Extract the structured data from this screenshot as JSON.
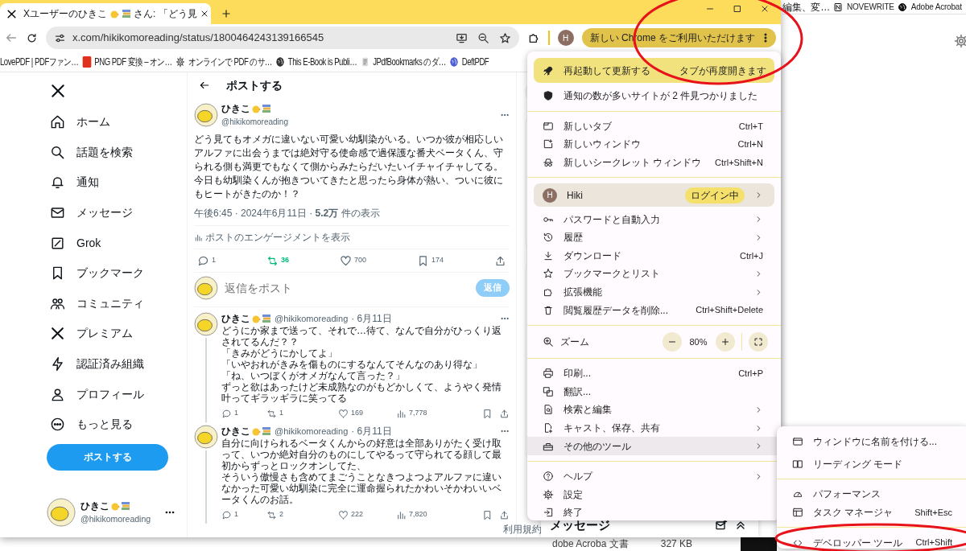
{
  "browser": {
    "tab_title_start": "Xユーザーのひきこ",
    "tab_title_end": "さん: 「どう見",
    "url": "x.com/hikikomoreading/status/1800464243139166545",
    "avatar": "H",
    "update_button": "新しい Chrome をご利用いただけます",
    "bookmarks": [
      {
        "label": "LovePDF | PDFファン…"
      },
      {
        "label": "PNG PDF 変換 – オン…"
      },
      {
        "label": "オンラインで PDF のサ…"
      },
      {
        "label": "This E-Book is Publi…"
      },
      {
        "label": "JPdfBookmarks のダ…"
      },
      {
        "label": "DeftPDF"
      }
    ]
  },
  "background_bookmarks": [
    {
      "label": "編集、変…"
    },
    {
      "label": "NOVEWRITE"
    },
    {
      "label": "Adobe Acrobat"
    }
  ],
  "nav": {
    "items": [
      {
        "label": "ホーム"
      },
      {
        "label": "話題を検索"
      },
      {
        "label": "通知"
      },
      {
        "label": "メッセージ"
      },
      {
        "label": "Grok"
      },
      {
        "label": "ブックマーク"
      },
      {
        "label": "コミュニティ"
      },
      {
        "label": "プレミアム"
      },
      {
        "label": "認証済み組織"
      },
      {
        "label": "プロフィール"
      },
      {
        "label": "もっと見る"
      }
    ],
    "post_button": "ポストする",
    "account": {
      "name": "ひきこ",
      "handle": "@hikikomoreading"
    }
  },
  "post": {
    "header": "ポストする",
    "name": "ひきこ",
    "handle": "@hikikomoreading",
    "paragraphs": [
      "どう見てもオメガに違いない可愛い幼馴染がいる。いつか彼が相応しいアルファに出会うまでは絶対守る使命感で過保護な番犬ベータくん、守られる側も満更でもなくて側からみたらだいたいイチャイチャしてる。",
      "今日も幼馴染くんが抱きついてきたと思ったら身体が熱い、ついに彼にもヒートがきたのか！？"
    ],
    "meta": "午後6:45 · 2024年6月11日 · **5.2万** 件の表示",
    "engagement": "ポストのエンゲージメントを表示",
    "stats": [
      {
        "count": "1",
        "active": false
      },
      {
        "count": "36",
        "active": true
      },
      {
        "count": "700",
        "active": false
      },
      {
        "count": "174",
        "active": false
      }
    ],
    "reply_placeholder": "返信をポスト",
    "reply_button": "返信",
    "reply_disabled": true
  },
  "replies": [
    {
      "name": "ひきこ",
      "handle": "@hikikomoreading",
      "date": "· 6月11日",
      "paragraphs": [
        "どうにか家まで送って、それで…待て、なんで自分がひっくり返されてるんだ？？",
        "「きみがどうにかしてよ」",
        "「いやおれがきみを傷ものにするなんてそんなのあり得な」",
        "「ね、いつぼくがオメガなんて言った？」",
        "ずっと欲はあったけど未成熟なのがもどかしくて、ようやく発情叶ってギラッギラに笑ってる"
      ],
      "stats": [
        {
          "count": "1"
        },
        {
          "count": "1"
        },
        {
          "count": "169"
        },
        {
          "count": "7,778"
        }
      ]
    },
    {
      "name": "ひきこ",
      "handle": "@hikikomoreading",
      "date": "· 6月11日",
      "paragraphs": [
        "自分に向けられるベータくんからの好意は全部ありがたく受け取って、いつか絶対自分のものにしてやるって守られてる顔して最初からずっとロックオンしてた、",
        "そういう傲慢さも含めてまごうことなきつよつよアルファに違いなかった可愛い幼馴染に完全に運命握られたかわいそかわいいベータくんのお話。"
      ],
      "stats": [
        {
          "count": "1"
        },
        {
          "count": "2"
        },
        {
          "count": "222"
        },
        {
          "count": "7,820"
        }
      ]
    }
  ],
  "drawer": {
    "title": "メッセージ"
  },
  "footer_link": "利用規約",
  "background_file": {
    "name": "dobe Acroba 文書",
    "size": "327 KB"
  },
  "menu": {
    "sections": [
      [
        {
          "kind": "update",
          "label": "再起動して更新する",
          "note": "タブが再度開きます",
          "selected": false
        },
        {
          "kind": "item",
          "label": "通知の数が多いサイトが 2 件見つかりました",
          "submenu": false,
          "selected": false
        }
      ],
      [
        {
          "kind": "item",
          "label": "新しいタブ",
          "shortcut": "Ctrl+T",
          "submenu": false,
          "selected": false
        },
        {
          "kind": "item",
          "label": "新しいウィンドウ",
          "shortcut": "Ctrl+N",
          "submenu": false,
          "selected": false
        },
        {
          "kind": "item",
          "label": "新しいシークレット ウィンドウ",
          "shortcut": "Ctrl+Shift+N",
          "submenu": false,
          "selected": false
        }
      ],
      [
        {
          "kind": "profile",
          "initial": "H",
          "label": "Hiki",
          "badge": "ログイン中",
          "submenu": true,
          "selected": false
        },
        {
          "kind": "item",
          "label": "パスワードと自動入力",
          "submenu": true,
          "selected": false
        },
        {
          "kind": "item",
          "label": "履歴",
          "submenu": true,
          "selected": false
        },
        {
          "kind": "item",
          "label": "ダウンロード",
          "shortcut": "Ctrl+J",
          "submenu": false,
          "selected": false
        },
        {
          "kind": "item",
          "label": "ブックマークとリスト",
          "submenu": true,
          "selected": false
        },
        {
          "kind": "item",
          "label": "拡張機能",
          "submenu": true,
          "selected": false
        },
        {
          "kind": "item",
          "label": "閲覧履歴データを削除...",
          "shortcut": "Ctrl+Shift+Delete",
          "submenu": false,
          "selected": false
        }
      ],
      [
        {
          "kind": "zoom",
          "label": "ズーム",
          "value": "80%",
          "selected": false
        }
      ],
      [
        {
          "kind": "item",
          "label": "印刷...",
          "shortcut": "Ctrl+P",
          "submenu": false,
          "selected": false
        },
        {
          "kind": "item",
          "label": "翻訳...",
          "submenu": false,
          "selected": false
        },
        {
          "kind": "item",
          "label": "検索と編集",
          "submenu": true,
          "selected": false
        },
        {
          "kind": "item",
          "label": "キャスト、保存、共有",
          "submenu": true,
          "selected": false
        },
        {
          "kind": "item",
          "label": "その他のツール",
          "submenu": true,
          "selected": true
        }
      ],
      [
        {
          "kind": "item",
          "label": "ヘルプ",
          "submenu": true,
          "selected": false
        },
        {
          "kind": "item",
          "label": "設定",
          "submenu": false,
          "selected": false
        },
        {
          "kind": "item",
          "label": "終了",
          "submenu": false,
          "selected": false
        }
      ]
    ]
  },
  "submenu": {
    "sections": [
      [
        {
          "kind": "item",
          "label": "ウィンドウに名前を付ける...",
          "submenu": false,
          "selected": false
        },
        {
          "kind": "item",
          "label": "リーディング モード",
          "submenu": false,
          "selected": false
        }
      ],
      [
        {
          "kind": "item",
          "label": "パフォーマンス",
          "submenu": false,
          "selected": false
        },
        {
          "kind": "item",
          "label": "タスク マネージャ",
          "shortcut": "Shift+Esc",
          "submenu": false,
          "selected": false
        }
      ],
      [
        {
          "kind": "item",
          "label": "デベロッパー ツール",
          "shortcut": "Ctrl+Shift",
          "submenu": false,
          "selected": false
        }
      ]
    ]
  },
  "annotations": [
    {
      "kind": "circle"
    },
    {
      "kind": "circle"
    }
  ]
}
